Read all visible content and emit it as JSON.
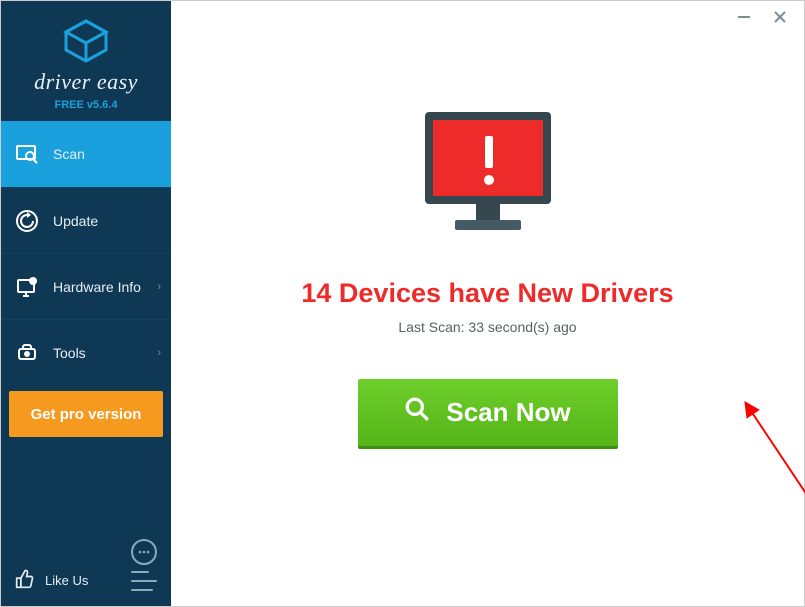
{
  "brand": {
    "name": "driver easy",
    "version": "FREE v5.6.4"
  },
  "sidebar": {
    "items": [
      {
        "label": "Scan"
      },
      {
        "label": "Update"
      },
      {
        "label": "Hardware Info"
      },
      {
        "label": "Tools"
      }
    ],
    "pro_button": "Get pro version",
    "like": "Like Us"
  },
  "main": {
    "headline": "14 Devices have New Drivers",
    "subline": "Last Scan: 33 second(s) ago",
    "scan_button": "Scan Now"
  },
  "colors": {
    "accent": "#1aa0dc",
    "sidebar_bg": "#0e3854",
    "danger": "#ee2b2b",
    "scan_green": "#5cc31f",
    "pro_orange": "#f59a1f"
  }
}
